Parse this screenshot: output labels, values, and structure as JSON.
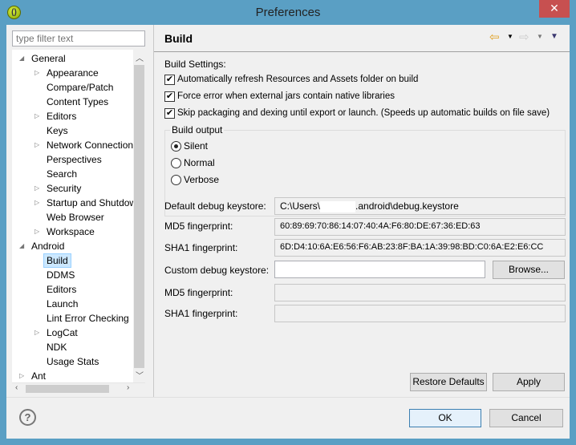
{
  "window": {
    "title": "Preferences",
    "close_icon": "close-icon"
  },
  "filter": {
    "placeholder": "type filter text"
  },
  "tree": [
    {
      "label": "General",
      "level": 0,
      "expanded": true
    },
    {
      "label": "Appearance",
      "level": 1,
      "collapsed": true
    },
    {
      "label": "Compare/Patch",
      "level": 1
    },
    {
      "label": "Content Types",
      "level": 1
    },
    {
      "label": "Editors",
      "level": 1,
      "collapsed": true
    },
    {
      "label": "Keys",
      "level": 1
    },
    {
      "label": "Network Connection",
      "level": 1,
      "collapsed": true
    },
    {
      "label": "Perspectives",
      "level": 1
    },
    {
      "label": "Search",
      "level": 1
    },
    {
      "label": "Security",
      "level": 1,
      "collapsed": true
    },
    {
      "label": "Startup and Shutdown",
      "level": 1,
      "collapsed": true
    },
    {
      "label": "Web Browser",
      "level": 1
    },
    {
      "label": "Workspace",
      "level": 1,
      "collapsed": true
    },
    {
      "label": "Android",
      "level": 0,
      "expanded": true
    },
    {
      "label": "Build",
      "level": 1,
      "selected": true
    },
    {
      "label": "DDMS",
      "level": 1
    },
    {
      "label": "Editors",
      "level": 1
    },
    {
      "label": "Launch",
      "level": 1
    },
    {
      "label": "Lint Error Checking",
      "level": 1
    },
    {
      "label": "LogCat",
      "level": 1,
      "collapsed": true
    },
    {
      "label": "NDK",
      "level": 1
    },
    {
      "label": "Usage Stats",
      "level": 1
    },
    {
      "label": "Ant",
      "level": 0,
      "collapsed": true
    }
  ],
  "page": {
    "title": "Build",
    "build_settings_label": "Build Settings:",
    "checkboxes": [
      {
        "label": "Automatically refresh Resources and Assets folder on build",
        "checked": true
      },
      {
        "label": "Force error when external jars contain native libraries",
        "checked": true
      },
      {
        "label": "Skip packaging and dexing until export or launch. (Speeds up automatic builds on file save)",
        "checked": true
      }
    ],
    "build_output": {
      "label": "Build output",
      "options": [
        "Silent",
        "Normal",
        "Verbose"
      ],
      "selected": "Silent"
    },
    "default_keystore_label": "Default debug keystore:",
    "default_keystore_prefix": "C:\\Users\\",
    "default_keystore_suffix": ".android\\debug.keystore",
    "md5_label": "MD5 fingerprint:",
    "md5_value": "60:89:69:70:86:14:07:40:4A:F6:80:DE:67:36:ED:63",
    "sha1_label": "SHA1 fingerprint:",
    "sha1_value": "6D:D4:10:6A:E6:56:F6:AB:23:8F:BA:1A:39:98:BD:C0:6A:E2:E6:CC",
    "custom_keystore_label": "Custom debug keystore:",
    "custom_keystore_value": "",
    "browse": "Browse...",
    "md5_label2": "MD5 fingerprint:",
    "sha1_label2": "SHA1 fingerprint:",
    "restore_defaults": "Restore Defaults",
    "apply": "Apply"
  },
  "footer": {
    "ok": "OK",
    "cancel": "Cancel",
    "help_icon": "help-icon"
  }
}
